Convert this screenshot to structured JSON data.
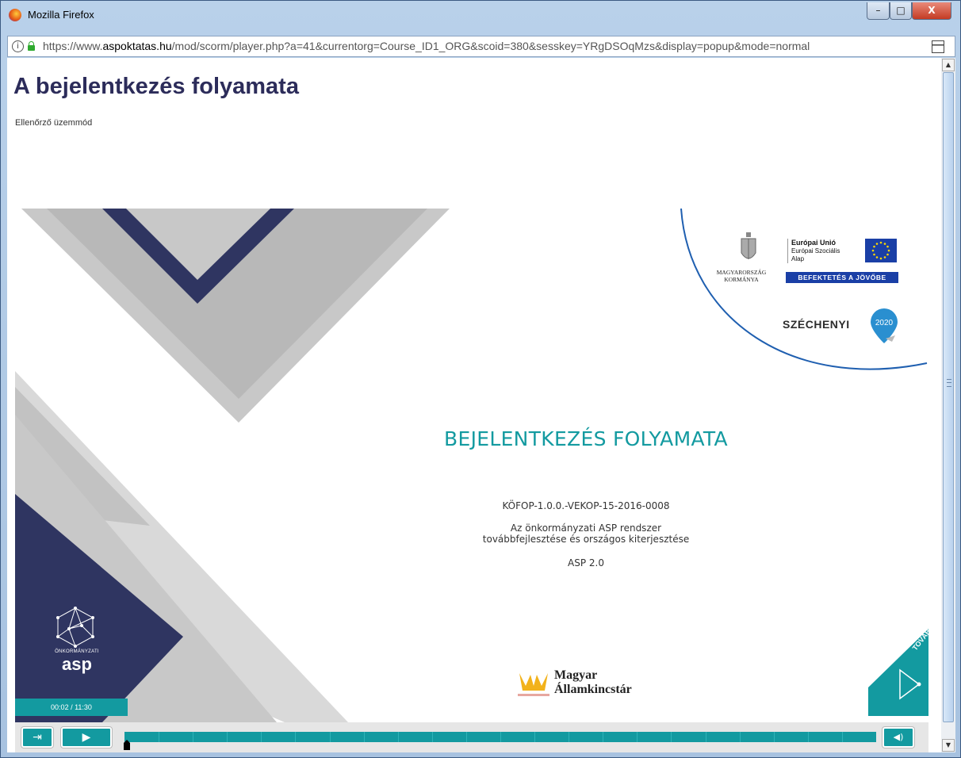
{
  "window": {
    "title": "Mozilla Firefox",
    "min_glyph": "–",
    "max_glyph": "□",
    "close_glyph": "X"
  },
  "urlbar": {
    "info_glyph": "i",
    "url_prefix": "https://www.",
    "url_domain": "aspoktatas.hu",
    "url_rest": "/mod/scorm/player.php?a=41&currentorg=Course_ID1_ORG&scoid=380&sesskey=YRgDSOqMzs&display=popup&mode=normal"
  },
  "page": {
    "title": "A bejelentkezés folyamata",
    "mode": "Ellenőrző üzemmód"
  },
  "slide": {
    "title": "BEJELENTKEZÉS FOLYAMATA",
    "project_code": "KÖFOP-1.0.0.-VEKOP-15-2016-0008",
    "project_desc_1": "Az önkormányzati ASP rendszer",
    "project_desc_2": "továbbfejlesztése és országos kiterjesztése",
    "version": "ASP 2.0",
    "gov_line1": "MAGYARORSZÁG",
    "gov_line2": "KORMÁNYA",
    "eu_line1": "Európai Unió",
    "eu_line2": "Európai Szociális",
    "eu_line3": "Alap",
    "eu_banner": "BEFEKTETÉS A JÖVŐBE",
    "szechenyi": "SZÉCHENYI",
    "szechenyi_year": "2020",
    "asp_small": "ÖNKORMÁNYZATI",
    "asp_big": "asp",
    "mak_line1": "Magyar",
    "mak_line2": "Államkincstár",
    "next_label": "TOVÁBB"
  },
  "player": {
    "time": "00:02 / 11:30",
    "exit_glyph": "⇥",
    "play_glyph": "▶",
    "volume_glyph": "◀)",
    "progress": 0.003
  },
  "colors": {
    "teal": "#139aa0",
    "navy": "#2f3561",
    "gray": "#c8c8c8"
  }
}
